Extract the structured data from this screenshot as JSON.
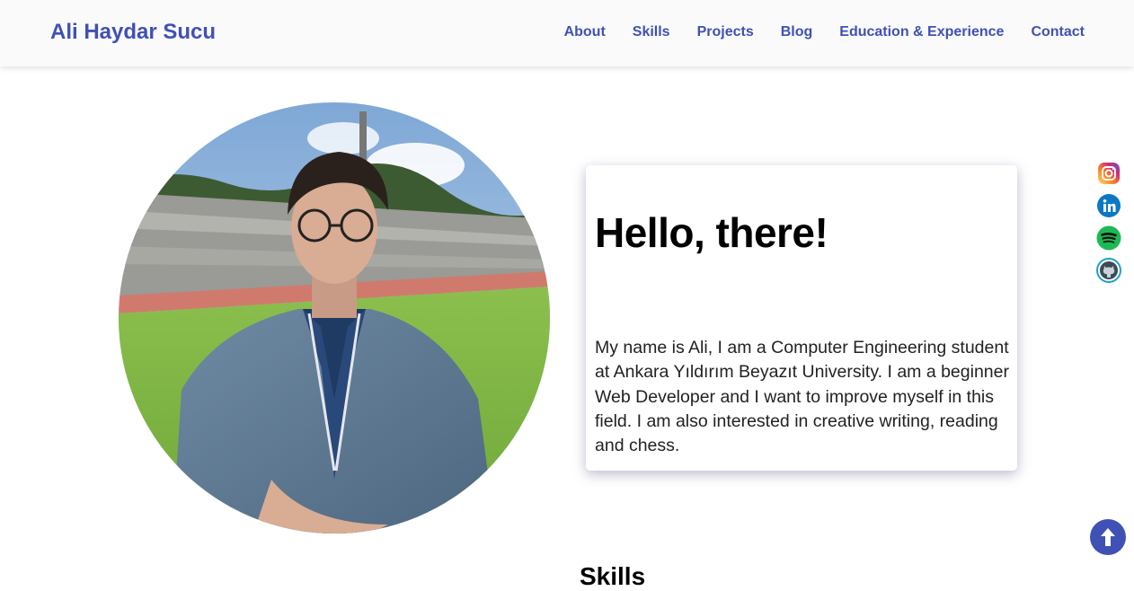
{
  "header": {
    "brand": "Ali Haydar Sucu",
    "nav": [
      {
        "label": "About"
      },
      {
        "label": "Skills"
      },
      {
        "label": "Projects"
      },
      {
        "label": "Blog"
      },
      {
        "label": "Education & Experience"
      },
      {
        "label": "Contact"
      }
    ]
  },
  "hero": {
    "greeting": "Hello, there!",
    "intro": "My name is Ali, I am a Computer Engineering student at Ankara Yıldırım Beyazıt University. I am a beginner Web Developer and I want to improve myself in this field. I am also interested in creative writing, reading and chess."
  },
  "social_links": [
    {
      "icon": "instagram-icon"
    },
    {
      "icon": "linkedin-icon"
    },
    {
      "icon": "spotify-icon"
    },
    {
      "icon": "github-icon"
    }
  ],
  "scroll_top": {
    "icon": "arrow-up-icon"
  },
  "next_section": {
    "title": "Skills"
  },
  "colors": {
    "accent": "#3f51b5",
    "navbar_bg": "#fafafa",
    "spotify": "#1db954",
    "linkedin": "#0a66c2"
  }
}
